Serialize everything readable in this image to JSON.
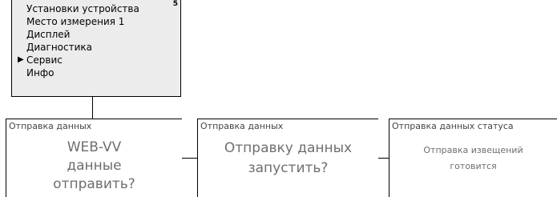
{
  "menu": {
    "page_number": "5",
    "items": [
      {
        "label": "Установки устройства",
        "selected": false
      },
      {
        "label": "Место измерения 1",
        "selected": false
      },
      {
        "label": "Дисплей",
        "selected": false
      },
      {
        "label": "Диагностика",
        "selected": false
      },
      {
        "label": "Сервис",
        "selected": true
      },
      {
        "label": "Инфо",
        "selected": false
      }
    ],
    "selector_icon": "right-triangle"
  },
  "panels": [
    {
      "title": "Отправка данных",
      "lines": [
        "WEB-VV",
        "данные",
        "отправить?"
      ]
    },
    {
      "title": "Отправка данных",
      "lines": [
        "Отправку данных",
        "запустить?"
      ]
    },
    {
      "title": "Отправка данных статуса",
      "lines": [
        "Отправка извещений",
        "готовится"
      ]
    }
  ]
}
